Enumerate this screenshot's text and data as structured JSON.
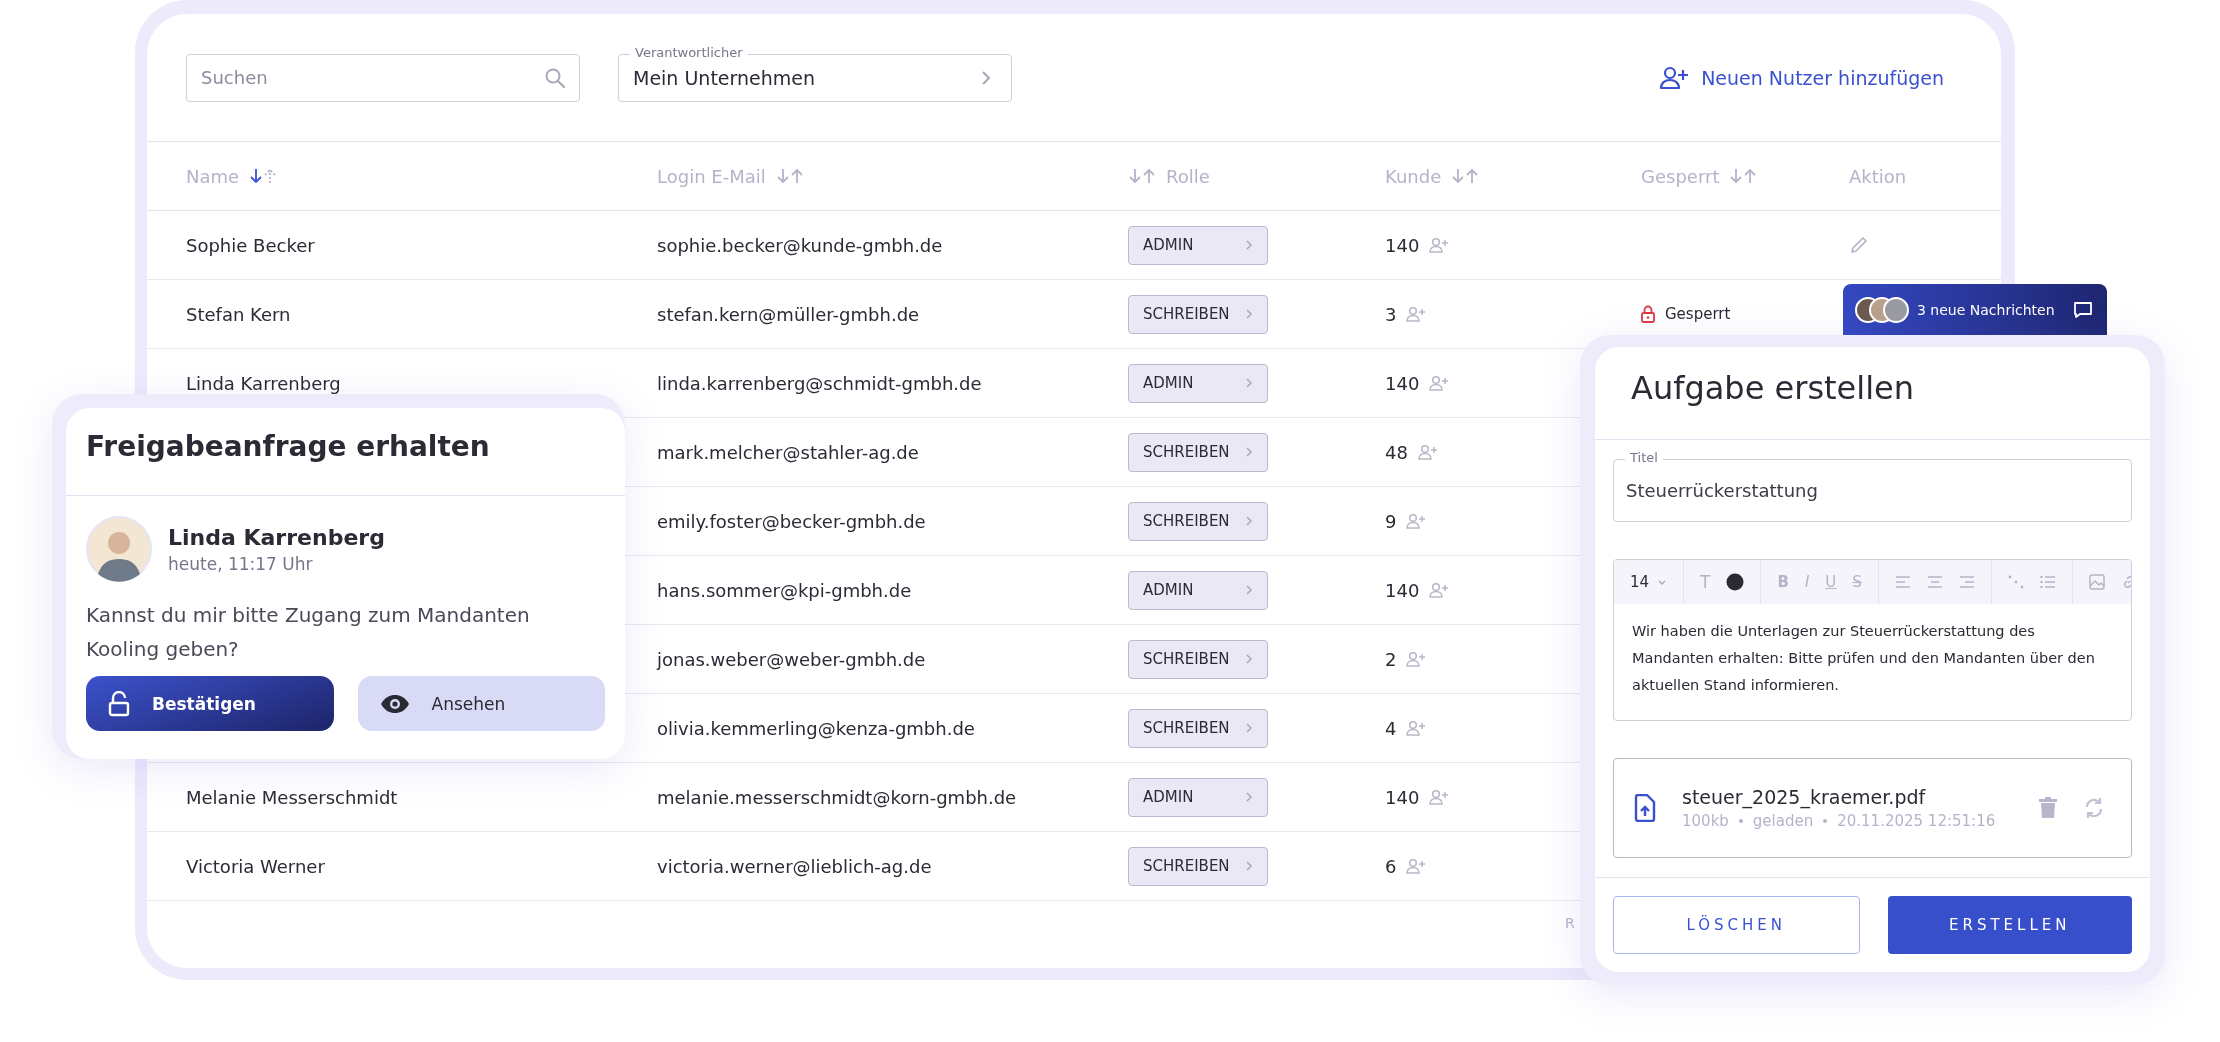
{
  "toolbar": {
    "search": {
      "placeholder": "Suchen"
    },
    "owner_select": {
      "label": "Verantwortlicher",
      "value": "Mein Unternehmen"
    },
    "add_user_link": "Neuen Nutzer hinzufügen"
  },
  "table": {
    "columns": [
      {
        "label": "Name",
        "kind": "sort_after",
        "sorted": true
      },
      {
        "label": "Login E-Mail",
        "kind": "sort_after",
        "sorted": false
      },
      {
        "label": "Rolle",
        "kind": "sort_before",
        "sorted": false
      },
      {
        "label": "Kunde",
        "kind": "sort_after",
        "sorted": false
      },
      {
        "label": "Gesperrt",
        "kind": "sort_after",
        "sorted": false
      },
      {
        "label": "Aktion",
        "kind": "plain"
      }
    ],
    "rows": [
      {
        "name": "Sophie Becker",
        "email": "sophie.becker@kunde-gmbh.de",
        "role": "ADMIN",
        "customers": "140",
        "locked": false,
        "editable": true
      },
      {
        "name": "Stefan Kern",
        "email": "stefan.kern@müller-gmbh.de",
        "role": "SCHREIBEN",
        "customers": "3",
        "locked": true,
        "lock_label": "Gesperrt"
      },
      {
        "name": "Linda Karrenberg",
        "email": "linda.karrenberg@schmidt-gmbh.de",
        "role": "ADMIN",
        "customers": "140"
      },
      {
        "email": "mark.melcher@stahler-ag.de",
        "role": "SCHREIBEN",
        "customers": "48"
      },
      {
        "email": "emily.foster@becker-gmbh.de",
        "role": "SCHREIBEN",
        "customers": "9"
      },
      {
        "email": "hans.sommer@kpi-gmbh.de",
        "role": "ADMIN",
        "customers": "140"
      },
      {
        "email": "jonas.weber@weber-gmbh.de",
        "role": "SCHREIBEN",
        "customers": "2"
      },
      {
        "email": "olivia.kemmerling@kenza-gmbh.de",
        "role": "SCHREIBEN",
        "customers": "4"
      },
      {
        "name": "Melanie Messerschmidt",
        "email": "melanie.messerschmidt@korn-gmbh.de",
        "role": "ADMIN",
        "customers": "140"
      },
      {
        "name": "Victoria Werner",
        "email": "victoria.werner@lieblich-ag.de",
        "role": "SCHREIBEN",
        "customers": "6"
      }
    ],
    "footer_text": "R"
  },
  "request_card": {
    "title": "Freigabeanfrage erhalten",
    "sender": {
      "name": "Linda Karrenberg",
      "time": "heute, 11:17 Uhr"
    },
    "message": "Kannst du mir bitte Zugang zum Mandanten Kooling geben?",
    "buttons": [
      {
        "label": "Bestätigen",
        "kind": "primary"
      },
      {
        "label": "Ansehen",
        "kind": "secondary"
      }
    ]
  },
  "messages_badge": {
    "label": "3 neue Nachrichten"
  },
  "task_card": {
    "title": "Aufgabe erstellen",
    "title_field": {
      "label": "Titel",
      "value": "Steuerrückerstattung"
    },
    "editor": {
      "font_size": "14",
      "format_buttons": [
        {
          "label": "B",
          "kind": "bold"
        },
        {
          "label": "I",
          "kind": "italic"
        },
        {
          "label": "U",
          "kind": "underline"
        },
        {
          "label": "S",
          "kind": "strike"
        }
      ],
      "text_button": "T",
      "body": "Wir haben die Unterlagen zur Steuerrückerstattung des Mandanten erhalten: Bitte prüfen und den Mandanten über den aktuellen Stand informieren."
    },
    "attachment": {
      "file_name": "steuer_2025_kraemer.pdf",
      "size": "100kb",
      "status": "geladen",
      "timestamp": "20.11.2025 12:51:16"
    },
    "buttons": [
      {
        "label": "LÖSCHEN",
        "kind": "secondary"
      },
      {
        "label": "ERSTELLEN",
        "kind": "primary"
      }
    ]
  }
}
